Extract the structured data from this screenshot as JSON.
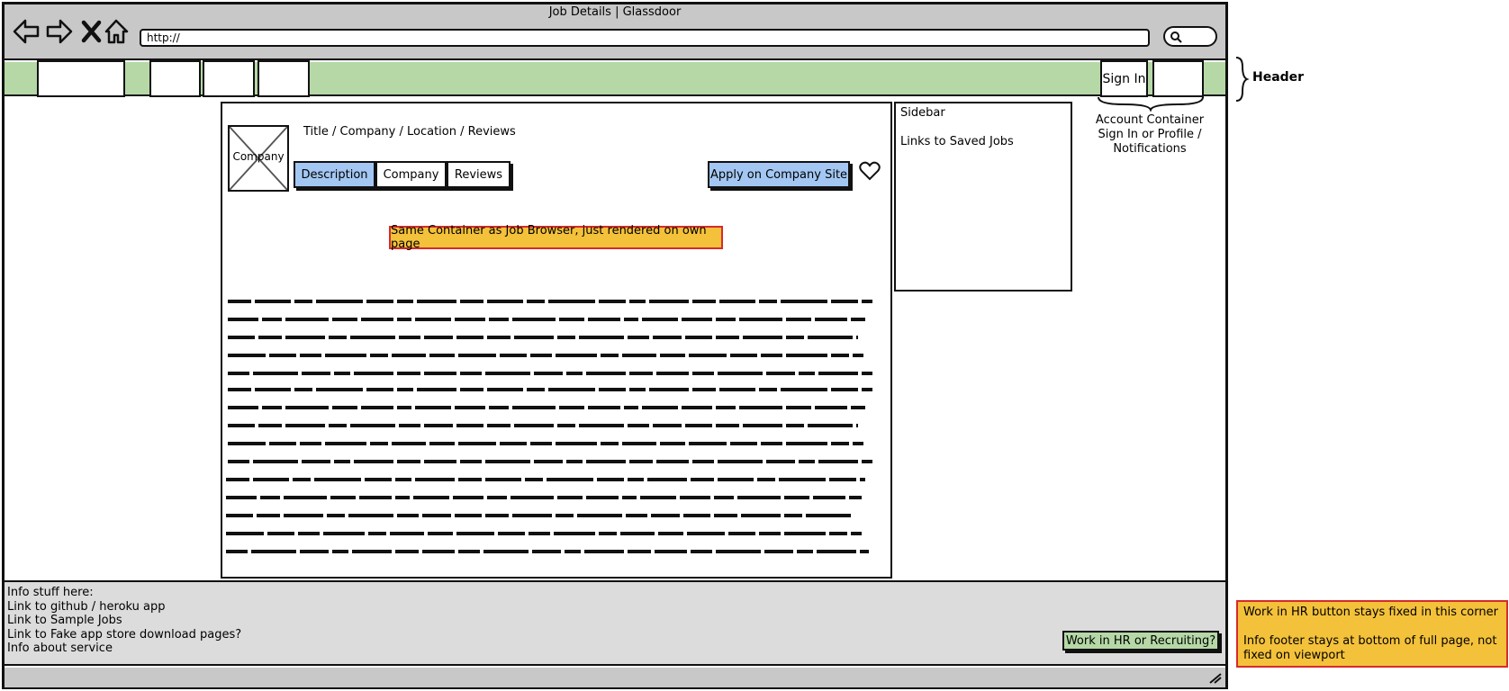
{
  "browser": {
    "title": "Job Details | Glassdoor",
    "url": "http://",
    "nav_icons": [
      "back-arrow-icon",
      "forward-arrow-icon",
      "stop-icon",
      "home-icon"
    ],
    "search_icon": "search-icon"
  },
  "header": {
    "sign_in_label": "Sign In",
    "brace_label": "Header",
    "account_container_lines": [
      "Account Container",
      "Sign In or Profile /",
      "Notifications"
    ],
    "bar_color": "#b5d8a6"
  },
  "job": {
    "company_logo_label": "Company",
    "meta": "Title / Company / Location / Reviews",
    "tabs": [
      {
        "label": "Description",
        "active": true
      },
      {
        "label": "Company",
        "active": false
      },
      {
        "label": "Reviews",
        "active": false
      }
    ],
    "apply_label": "Apply on Company Site",
    "save_icon": "heart-icon",
    "note": "Same Container as Job Browser, just rendered on own page",
    "paragraph_count": 3
  },
  "sidebar": {
    "title": "Sidebar",
    "link": "Links to Saved Jobs"
  },
  "footer": {
    "lines": [
      "Info stuff here:",
      "Link to github / heroku app",
      "Link to Sample Jobs",
      "Link to Fake app store download pages?",
      "Info about service"
    ],
    "hr_button_label": "Work in HR or Recruiting?"
  },
  "callout": {
    "line1": "Work in HR button stays fixed in this corner",
    "line2": "Info footer stays at bottom of full page, not fixed on viewport"
  },
  "colors": {
    "accent_blue": "#a3c7f2",
    "note_yellow": "#f4c13a",
    "note_border": "#d62b2b",
    "footer_gray": "#dcdcdc"
  }
}
